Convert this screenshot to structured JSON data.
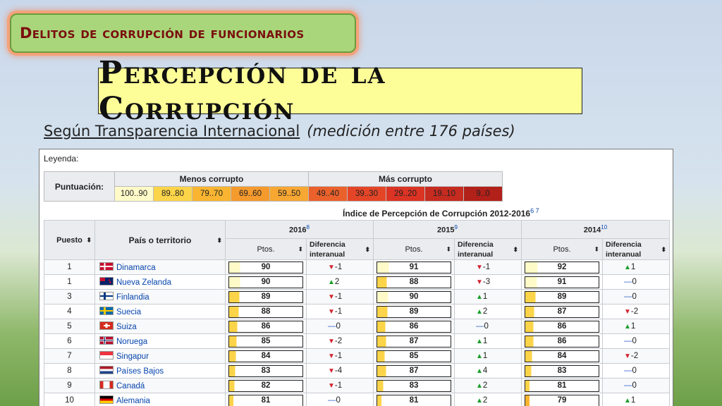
{
  "slide": {
    "badge": "Delitos de corrupción de funcionarios",
    "title": "Percepción de la Corrupción",
    "subtitle_underlined": "Según Transparencia Internacional",
    "subtitle_italic": "(medición entre 176 países)"
  },
  "legend": {
    "title": "Leyenda:",
    "row_label": "Puntuación:",
    "less_corrupt": "Menos corrupto",
    "more_corrupt": "Más corrupto",
    "ranges": [
      {
        "label": "100..90",
        "color": "#fffbc9"
      },
      {
        "label": "89..80",
        "color": "#fcd449"
      },
      {
        "label": "79..70",
        "color": "#f9b531"
      },
      {
        "label": "69..60",
        "color": "#f59a2d"
      },
      {
        "label": "59..50",
        "color": "#f7a732"
      },
      {
        "label": "49..40",
        "color": "#eb612b"
      },
      {
        "label": "39..30",
        "color": "#e44527"
      },
      {
        "label": "29..20",
        "color": "#db3324"
      },
      {
        "label": "19..10",
        "color": "#c62b20"
      },
      {
        "label": "9..0",
        "color": "#b2201a"
      }
    ]
  },
  "index_title": "Índice de Percepción de Corrupción 2012-2016",
  "index_refs": "6 7",
  "headers": {
    "rank": "Puesto",
    "country": "País o territorio",
    "years": [
      {
        "year": "2016",
        "ref": "8"
      },
      {
        "year": "2015",
        "ref": "9"
      },
      {
        "year": "2014",
        "ref": "10"
      }
    ],
    "pts": "Ptos.",
    "diff": "Diferencia interanual"
  },
  "colors": {
    "up": "#1a9d2a",
    "down": "#d1242f",
    "same": "#3366cc",
    "score_fill": "#fcd449"
  },
  "rows": [
    {
      "rank": "1",
      "country": "Dinamarca",
      "flag": "denmark-flag",
      "s2016": 90,
      "d2016": "-1",
      "s2015": 91,
      "d2015": "-1",
      "s2014": 92,
      "d2014": "1"
    },
    {
      "rank": "1",
      "country": "Nueva Zelanda",
      "flag": "new-zealand-flag",
      "s2016": 90,
      "d2016": "2",
      "s2015": 88,
      "d2015": "-3",
      "s2014": 91,
      "d2014": "0"
    },
    {
      "rank": "3",
      "country": "Finlandia",
      "flag": "finland-flag",
      "s2016": 89,
      "d2016": "-1",
      "s2015": 90,
      "d2015": "1",
      "s2014": 89,
      "d2014": "0"
    },
    {
      "rank": "4",
      "country": "Suecia",
      "flag": "sweden-flag",
      "s2016": 88,
      "d2016": "-1",
      "s2015": 89,
      "d2015": "2",
      "s2014": 87,
      "d2014": "-2"
    },
    {
      "rank": "5",
      "country": "Suiza",
      "flag": "switzerland-flag",
      "s2016": 86,
      "d2016": "0",
      "s2015": 86,
      "d2015": "0",
      "s2014": 86,
      "d2014": "1"
    },
    {
      "rank": "6",
      "country": "Noruega",
      "flag": "norway-flag",
      "s2016": 85,
      "d2016": "-2",
      "s2015": 87,
      "d2015": "1",
      "s2014": 86,
      "d2014": "0"
    },
    {
      "rank": "7",
      "country": "Singapur",
      "flag": "singapore-flag",
      "s2016": 84,
      "d2016": "-1",
      "s2015": 85,
      "d2015": "1",
      "s2014": 84,
      "d2014": "-2"
    },
    {
      "rank": "8",
      "country": "Países Bajos",
      "flag": "netherlands-flag",
      "s2016": 83,
      "d2016": "-4",
      "s2015": 87,
      "d2015": "4",
      "s2014": 83,
      "d2014": "0"
    },
    {
      "rank": "9",
      "country": "Canadá",
      "flag": "canada-flag",
      "s2016": 82,
      "d2016": "-1",
      "s2015": 83,
      "d2015": "2",
      "s2014": 81,
      "d2014": "0"
    },
    {
      "rank": "10",
      "country": "Alemania",
      "flag": "germany-flag",
      "s2016": 81,
      "d2016": "0",
      "s2015": 81,
      "d2015": "2",
      "s2014": 79,
      "d2014": "1"
    }
  ]
}
